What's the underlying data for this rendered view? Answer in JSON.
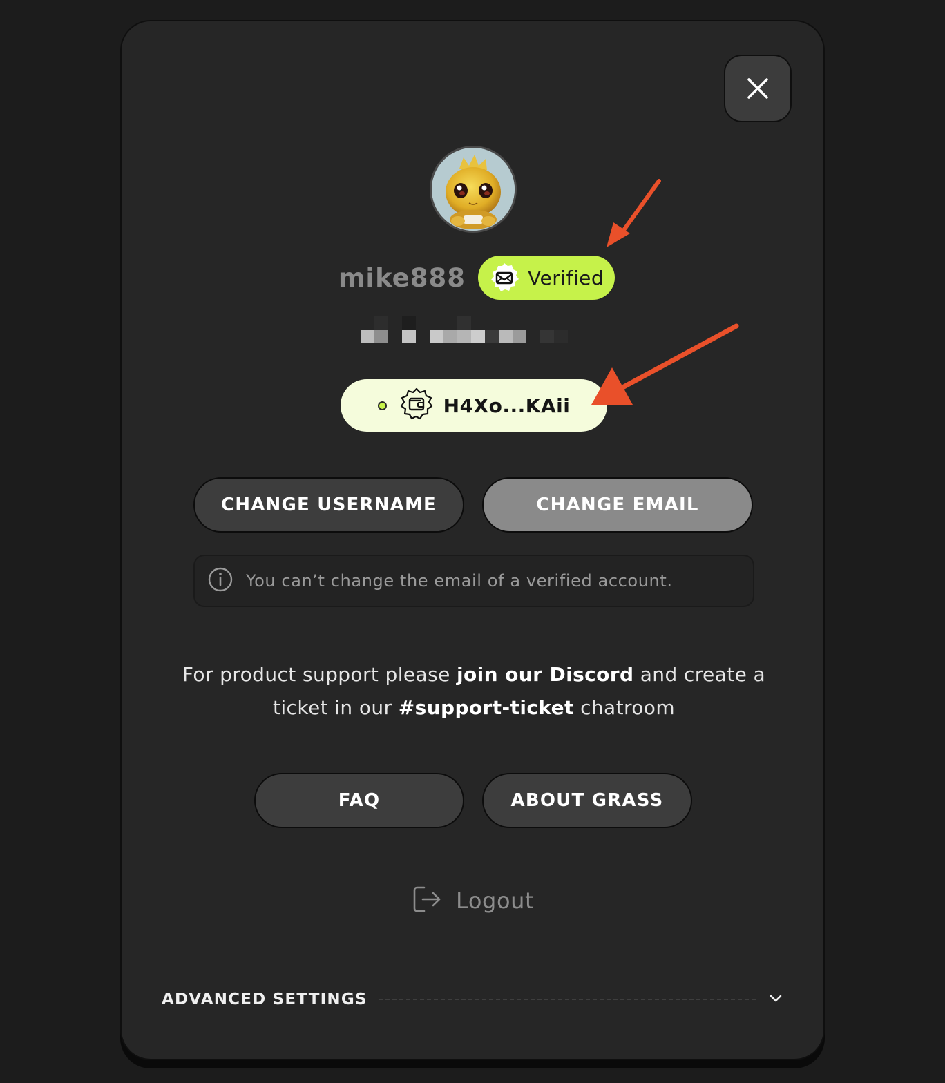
{
  "profile": {
    "username": "mike888",
    "verified_label": "Verified",
    "wallet_address": "H4Xo...KAii"
  },
  "buttons": {
    "change_username": "CHANGE USERNAME",
    "change_email": "CHANGE EMAIL",
    "faq": "FAQ",
    "about_grass": "ABOUT GRASS"
  },
  "info": {
    "message": "You can’t change the email of a verified account."
  },
  "support": {
    "part1": "For product support please ",
    "link_discord": "join our Discord",
    "part2": " and create a ticket in our ",
    "channel": "#support-ticket",
    "part3": " chatroom"
  },
  "logout": {
    "label": "Logout"
  },
  "advanced": {
    "label": "ADVANCED SETTINGS"
  },
  "colors": {
    "accent_green": "#c6f24a",
    "wallet_bg": "#f5fcdc",
    "annotation_arrow": "#e9502a",
    "modal_bg": "#262626"
  },
  "icons": {
    "close": "close-icon",
    "verified": "envelope-badge-icon",
    "wallet": "wallet-badge-icon",
    "info": "info-icon",
    "logout": "logout-icon",
    "chevron": "chevron-down-icon"
  }
}
